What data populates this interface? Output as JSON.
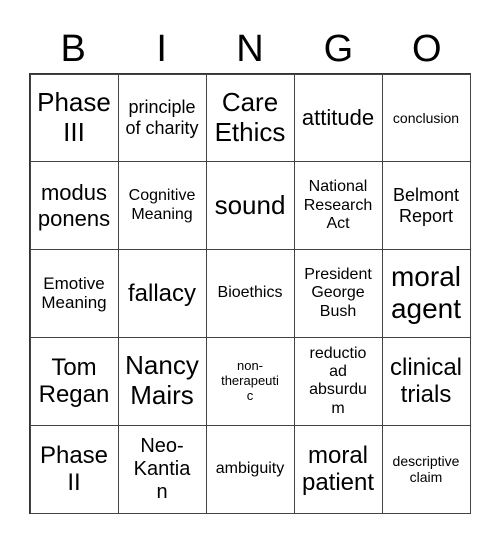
{
  "header": {
    "letters": [
      "B",
      "I",
      "N",
      "G",
      "O"
    ]
  },
  "grid": {
    "rows": [
      [
        {
          "text": "Phase III"
        },
        {
          "text": "principle of charity"
        },
        {
          "text": "Care Ethics"
        },
        {
          "text": "attitude"
        },
        {
          "text": "conclusion"
        }
      ],
      [
        {
          "text": "modus ponens"
        },
        {
          "text": "Cognitive Meaning"
        },
        {
          "text": "sound"
        },
        {
          "text": "National Research Act"
        },
        {
          "text": "Belmont Report"
        }
      ],
      [
        {
          "text": "Emotive Meaning"
        },
        {
          "text": "fallacy"
        },
        {
          "text": "Bioethics"
        },
        {
          "text": "President George Bush"
        },
        {
          "text": "moral agent"
        }
      ],
      [
        {
          "text": "Tom Regan"
        },
        {
          "text": "Nancy Mairs"
        },
        {
          "text": "non-therapeutic"
        },
        {
          "text": "reductio ad absurdum"
        },
        {
          "text": "clinical trials"
        }
      ],
      [
        {
          "text": "Phase II"
        },
        {
          "text": "Neo-Kantian"
        },
        {
          "text": "ambiguity"
        },
        {
          "text": "moral patient"
        },
        {
          "text": "descriptive claim"
        }
      ]
    ]
  }
}
